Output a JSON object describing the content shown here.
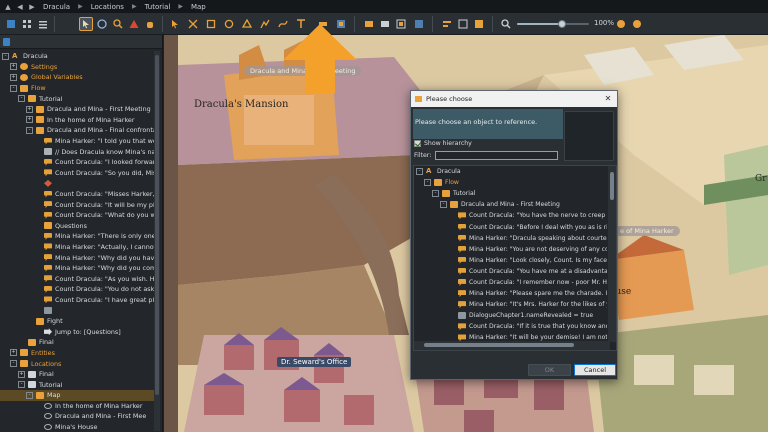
{
  "breadcrumb": [
    "Dracula",
    "Locations",
    "Tutorial",
    "Map"
  ],
  "toolbar": {
    "zoom_value": 0.62,
    "zoom_label": "100%"
  },
  "left_tree": [
    {
      "d": 0,
      "exp": "-",
      "ico": "proj",
      "text": "Dracula",
      "cls": ""
    },
    {
      "d": 1,
      "exp": "+",
      "ico": "gear",
      "text": "Settings",
      "cls": "lbl-orange"
    },
    {
      "d": 1,
      "exp": "+",
      "ico": "globe",
      "text": "Global Variables",
      "cls": "lbl-orange"
    },
    {
      "d": 1,
      "exp": "-",
      "ico": "folder",
      "text": "Flow",
      "cls": "lbl-orange"
    },
    {
      "d": 2,
      "exp": "-",
      "ico": "folder",
      "text": "Tutorial",
      "cls": ""
    },
    {
      "d": 3,
      "exp": "+",
      "ico": "folder",
      "text": "Dracula and Mina - First Meeting",
      "cls": ""
    },
    {
      "d": 3,
      "exp": "+",
      "ico": "folder",
      "text": "In the home of Mina Harker",
      "cls": ""
    },
    {
      "d": 3,
      "exp": "-",
      "ico": "folder",
      "text": "Dracula and Mina - Final confrontation",
      "cls": ""
    },
    {
      "d": 4,
      "exp": "",
      "ico": "note",
      "text": "Mina Harker: \"I told you that we wi",
      "cls": ""
    },
    {
      "d": 4,
      "exp": "",
      "ico": "cmt",
      "text": "// Does Dracula know Mina's name",
      "cls": ""
    },
    {
      "d": 4,
      "exp": "",
      "ico": "note",
      "text": "Count Dracula: \"I looked forward t",
      "cls": ""
    },
    {
      "d": 4,
      "exp": "",
      "ico": "note",
      "text": "Count Dracula: \"So you did, Miss M",
      "cls": ""
    },
    {
      "d": 4,
      "exp": "",
      "ico": "cond",
      "text": "",
      "cls": ""
    },
    {
      "d": 4,
      "exp": "",
      "ico": "note",
      "text": "Count Dracula: \"Misses Harker, if you",
      "cls": ""
    },
    {
      "d": 4,
      "exp": "",
      "ico": "note",
      "text": "Count Dracula: \"It will be my pleas",
      "cls": ""
    },
    {
      "d": 4,
      "exp": "",
      "ico": "note",
      "text": "Count Dracula: \"What do you want",
      "cls": ""
    },
    {
      "d": 4,
      "exp": "",
      "ico": "folder",
      "text": "Questions",
      "cls": ""
    },
    {
      "d": 4,
      "exp": "",
      "ico": "note",
      "text": "Mina Harker: \"There is only one qu",
      "cls": ""
    },
    {
      "d": 4,
      "exp": "",
      "ico": "note",
      "text": "Mina Harker: \"Actually, I cannot th",
      "cls": ""
    },
    {
      "d": 4,
      "exp": "",
      "ico": "note",
      "text": "Mina Harker: \"Why did you have tc",
      "cls": ""
    },
    {
      "d": 4,
      "exp": "",
      "ico": "note",
      "text": "Mina Harker: \"Why did you come t",
      "cls": ""
    },
    {
      "d": 4,
      "exp": "",
      "ico": "note",
      "text": "Count Dracula: \"As you wish. How",
      "cls": ""
    },
    {
      "d": 4,
      "exp": "",
      "ico": "note",
      "text": "Count Dracula: \"You do not ask the",
      "cls": ""
    },
    {
      "d": 4,
      "exp": "",
      "ico": "note",
      "text": "Count Dracula: \"I have great plans",
      "cls": ""
    },
    {
      "d": 4,
      "exp": "",
      "ico": "var",
      "text": "",
      "cls": ""
    },
    {
      "d": 3,
      "exp": "",
      "ico": "folder",
      "text": "Fight",
      "cls": ""
    },
    {
      "d": 4,
      "exp": "",
      "ico": "jump",
      "text": "Jump to: [Questions]",
      "cls": ""
    },
    {
      "d": 2,
      "exp": "",
      "ico": "folder",
      "text": "Final",
      "cls": ""
    },
    {
      "d": 1,
      "exp": "+",
      "ico": "folder",
      "text": "Entities",
      "cls": "lbl-orange"
    },
    {
      "d": 1,
      "exp": "-",
      "ico": "folder",
      "text": "Locations",
      "cls": "lbl-orange"
    },
    {
      "d": 2,
      "exp": "+",
      "ico": "doc",
      "text": "Final",
      "cls": ""
    },
    {
      "d": 2,
      "exp": "-",
      "ico": "doc",
      "text": "Tutorial",
      "cls": ""
    },
    {
      "d": 3,
      "exp": "-",
      "ico": "folder",
      "text": "Map",
      "cls": "",
      "selected": true
    },
    {
      "d": 4,
      "exp": "",
      "ico": "eye",
      "text": "In the home of Mina Harker",
      "cls": ""
    },
    {
      "d": 4,
      "exp": "",
      "ico": "eye",
      "text": "Dracula and Mina - First Mee",
      "cls": ""
    },
    {
      "d": 4,
      "exp": "",
      "ico": "eye",
      "text": "Mina's House",
      "cls": ""
    }
  ],
  "map": {
    "title": "Dracula's Mansion",
    "ghost_label": "Dracula and Mina - First Meeting",
    "office_label": "Dr. Seward's Office",
    "right_ghost": "e of Mina Harker",
    "house_word": "ouse",
    "gr_word": "Gr"
  },
  "dialog": {
    "title": "Please choose",
    "header": "Please choose an object to reference.",
    "show_hierarchy": "Show hierarchy",
    "filter_label": "Filter:",
    "filter_value": "",
    "ok": "OK",
    "cancel": "Cancel",
    "rows": [
      {
        "d": 0,
        "exp": "-",
        "ico": "proj",
        "text": "Dracula",
        "cls": ""
      },
      {
        "d": 1,
        "exp": "-",
        "ico": "folder",
        "text": "Flow",
        "cls": "lbl-orange"
      },
      {
        "d": 2,
        "exp": "-",
        "ico": "folder",
        "text": "Tutorial",
        "cls": ""
      },
      {
        "d": 3,
        "exp": "-",
        "ico": "folder",
        "text": "Dracula and Mina - First Meeting",
        "cls": ""
      },
      {
        "d": 4,
        "exp": "",
        "ico": "note",
        "text": "Count Dracula: \"You have the nerve to creep in to",
        "cls": ""
      },
      {
        "d": 4,
        "exp": "",
        "ico": "note",
        "text": "Count Dracula: \"Before I deal with you as is right...",
        "cls": ""
      },
      {
        "d": 4,
        "exp": "",
        "ico": "note",
        "text": "Mina Harker: \"Dracula speaking about courtesy? Y",
        "cls": ""
      },
      {
        "d": 4,
        "exp": "",
        "ico": "note",
        "text": "Mina Harker: \"You are not deserving of any courte",
        "cls": ""
      },
      {
        "d": 4,
        "exp": "",
        "ico": "note",
        "text": "Mina Harker: \"Look closely, Count. Is my face not",
        "cls": ""
      },
      {
        "d": 4,
        "exp": "",
        "ico": "note",
        "text": "Count Dracula: \"You have me at a disadvantage, M",
        "cls": ""
      },
      {
        "d": 4,
        "exp": "",
        "ico": "note",
        "text": "Count Dracula: \"I remember now - poor Mr. Harke",
        "cls": ""
      },
      {
        "d": 4,
        "exp": "",
        "ico": "note",
        "text": "Mina Harker: \"Please spare me the charade. I know",
        "cls": ""
      },
      {
        "d": 4,
        "exp": "",
        "ico": "note",
        "text": "Mina Harker: \"It's Mrs. Harker for the likes of y...\"",
        "cls": ""
      },
      {
        "d": 4,
        "exp": "",
        "ico": "var",
        "text": "DialogueChapter1.nameRevealed = true",
        "cls": ""
      },
      {
        "d": 4,
        "exp": "",
        "ico": "note",
        "text": "Count Dracula: \"If it is true that you know and unc",
        "cls": ""
      },
      {
        "d": 4,
        "exp": "",
        "ico": "note",
        "text": "Mina Harker: \"It will be your demise! I am not as...",
        "cls": ""
      }
    ]
  },
  "colors": {
    "accent": "#e9a23b",
    "dialog_header": "#3d5b66",
    "selection": "#5b4a24"
  }
}
